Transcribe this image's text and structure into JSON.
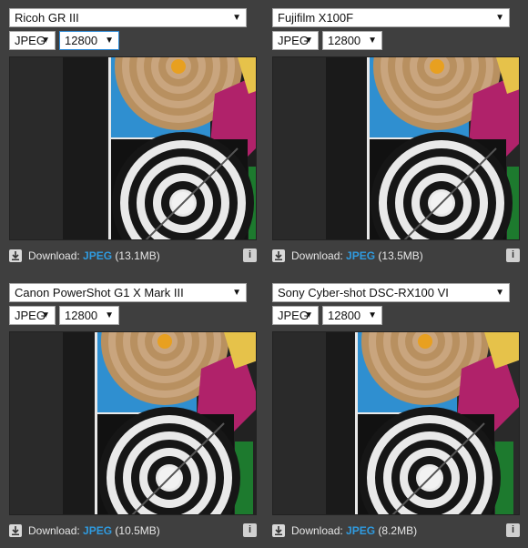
{
  "panels": [
    {
      "camera": "Ricoh GR III",
      "format": "JPEG",
      "iso": "12800",
      "download_label": "Download:",
      "download_type": "JPEG",
      "download_size": "(13.1MB)"
    },
    {
      "camera": "Fujifilm X100F",
      "format": "JPEG",
      "iso": "12800",
      "download_label": "Download:",
      "download_type": "JPEG",
      "download_size": "(13.5MB)"
    },
    {
      "camera": "Canon PowerShot G1 X Mark III",
      "format": "JPEG",
      "iso": "12800",
      "download_label": "Download:",
      "download_type": "JPEG",
      "download_size": "(10.5MB)"
    },
    {
      "camera": "Sony Cyber-shot DSC-RX100 VI",
      "format": "JPEG",
      "iso": "12800",
      "download_label": "Download:",
      "download_type": "JPEG",
      "download_size": "(8.2MB)"
    }
  ],
  "icons": {
    "dropdown": "chevron-down-icon",
    "download": "download-icon",
    "info": "info-icon"
  },
  "colors": {
    "background": "#3f3f3f",
    "accent": "#2f9be0"
  }
}
